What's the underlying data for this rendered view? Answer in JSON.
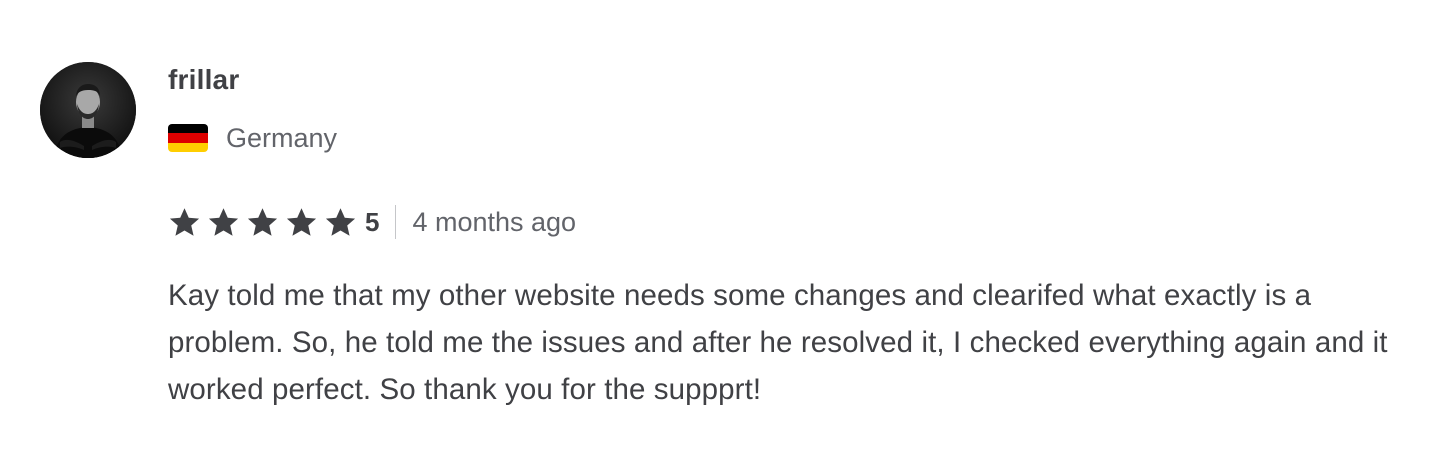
{
  "review": {
    "username": "frillar",
    "country": "Germany",
    "rating": "5",
    "rating_stars": 5,
    "time_ago": "4 months ago",
    "text": "Kay told me that my other website needs some changes and clearifed what exactly is a problem. So, he told me the issues and after he resolved it, I checked everything again and it worked perfect. So thank you for the suppprt!"
  },
  "icons": {
    "avatar": "user-avatar-photo",
    "flag": "germany-flag-icon",
    "star": "star-icon"
  },
  "colors": {
    "text_primary": "#404145",
    "text_secondary": "#62646a",
    "star": "#404145",
    "flag_black": "#000000",
    "flag_red": "#dd0000",
    "flag_gold": "#ffce00"
  }
}
